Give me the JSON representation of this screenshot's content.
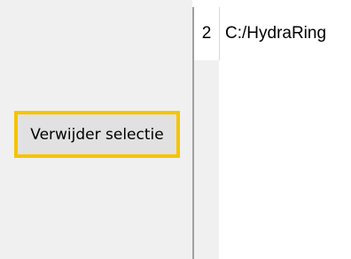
{
  "left_panel": {
    "delete_selection_label": "Verwijder selectie"
  },
  "grid": {
    "rows": [
      {
        "row_number": "2",
        "path": "C:/HydraRing"
      }
    ]
  },
  "colors": {
    "focus_border": "#f5c400",
    "panel_background": "#f0f0f0",
    "button_background": "#e1e1e1"
  }
}
